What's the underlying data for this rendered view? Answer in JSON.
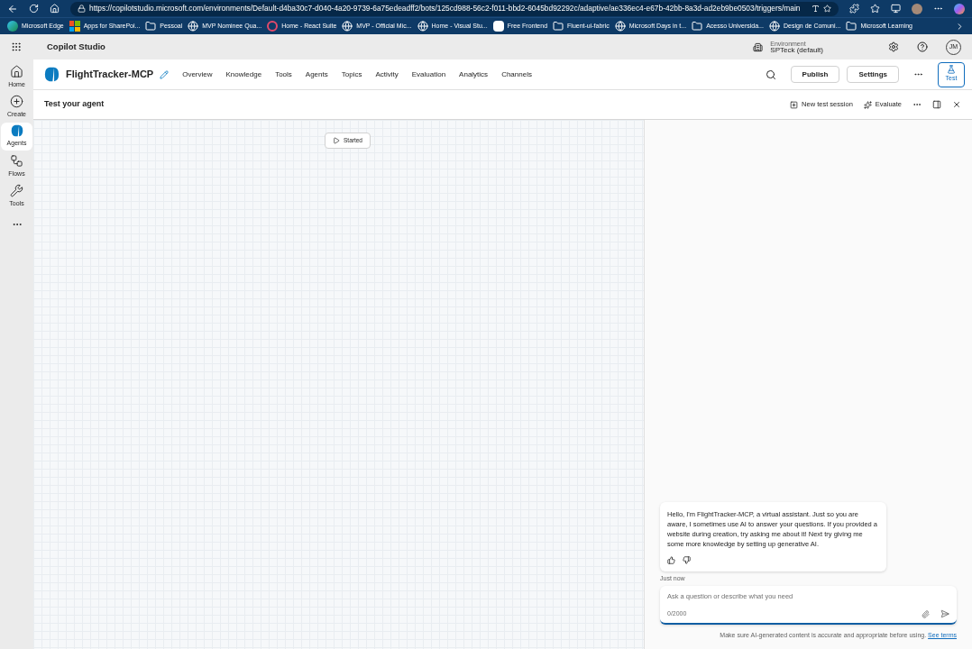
{
  "browser": {
    "url": "https://copilotstudio.microsoft.com/environments/Default-d4ba30c7-d040-4a20-9739-6a75edeadff2/bots/125cd988-56c2-f011-bbd2-6045bd92292c/adaptive/ae336ec4-e67b-42bb-8a3d-ad2eb9be0503/triggers/main",
    "bookmarks": [
      {
        "label": "Microsoft Edge",
        "kind": "edge"
      },
      {
        "label": "Apps for SharePoi...",
        "kind": "grid"
      },
      {
        "label": "Pessoal",
        "kind": "folder"
      },
      {
        "label": "MVP Nominee Qua...",
        "kind": "globe"
      },
      {
        "label": "Home - React Suite",
        "kind": "suite"
      },
      {
        "label": "MVP - Official Mic...",
        "kind": "globe"
      },
      {
        "label": "Home - Visual Stu...",
        "kind": "globe"
      },
      {
        "label": "Free Frontend",
        "kind": "f"
      },
      {
        "label": "Fluent-ui-fabric",
        "kind": "folder"
      },
      {
        "label": "Microsoft Days in t...",
        "kind": "globe"
      },
      {
        "label": "Acesso Universida...",
        "kind": "folder"
      },
      {
        "label": "Design de Comuni...",
        "kind": "globe"
      },
      {
        "label": "Microsoft Learning",
        "kind": "folder"
      }
    ]
  },
  "app": {
    "title": "Copilot Studio",
    "environment_label": "Environment",
    "environment": "SPTeck (default)",
    "avatar": "JM"
  },
  "rail": [
    {
      "label": "Home",
      "kind": "home",
      "selected": false
    },
    {
      "label": "Create",
      "kind": "create",
      "selected": false
    },
    {
      "label": "Agents",
      "kind": "agents",
      "selected": true
    },
    {
      "label": "Flows",
      "kind": "flows",
      "selected": false
    },
    {
      "label": "Tools",
      "kind": "tools",
      "selected": false
    }
  ],
  "agent": {
    "name": "FlightTracker-MCP",
    "nav": [
      "Overview",
      "Knowledge",
      "Tools",
      "Agents",
      "Topics",
      "Activity",
      "Evaluation",
      "Analytics",
      "Channels"
    ],
    "publish": "Publish",
    "settings": "Settings",
    "test": "Test"
  },
  "test_bar": {
    "title": "Test your agent",
    "new_session": "New test session",
    "evaluate": "Evaluate"
  },
  "canvas": {
    "node": "Started"
  },
  "chat": {
    "message": "Hello, I'm FlightTracker-MCP, a virtual assistant. Just so you are aware, I sometimes use AI to answer your questions. If you provided a website during creation, try asking me about it! Next try giving me some more knowledge by setting up generative AI.",
    "time": "Just now",
    "placeholder": "Ask a question or describe what you need",
    "counter": "0/2000",
    "disclaimer": "Make sure AI-generated content is accurate and appropriate before using.",
    "terms": "See terms"
  }
}
